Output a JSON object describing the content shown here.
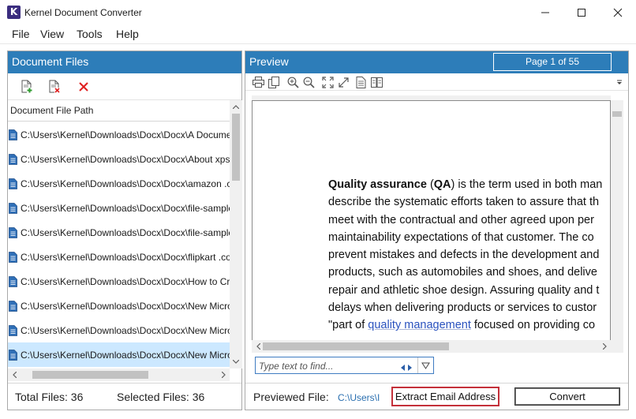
{
  "window": {
    "title": "Kernel Document Converter",
    "logo_letter": "K"
  },
  "menu": [
    "File",
    "View",
    "Tools",
    "Help"
  ],
  "left_panel": {
    "header": "Document Files",
    "column_header": "Document File Path",
    "files": [
      "C:\\Users\\Kernel\\Downloads\\Docx\\Docx\\A Document",
      "C:\\Users\\Kernel\\Downloads\\Docx\\Docx\\About xps.",
      "C:\\Users\\Kernel\\Downloads\\Docx\\Docx\\amazon .co",
      "C:\\Users\\Kernel\\Downloads\\Docx\\Docx\\file-sample",
      "C:\\Users\\Kernel\\Downloads\\Docx\\Docx\\file-sample",
      "C:\\Users\\Kernel\\Downloads\\Docx\\Docx\\flipkart .co",
      "C:\\Users\\Kernel\\Downloads\\Docx\\Docx\\How to Cre",
      "C:\\Users\\Kernel\\Downloads\\Docx\\Docx\\New Micro",
      "C:\\Users\\Kernel\\Downloads\\Docx\\Docx\\New Micro",
      "C:\\Users\\Kernel\\Downloads\\Docx\\Docx\\New Micro"
    ],
    "selected_index": 9,
    "total_files": "Total Files: 36",
    "selected_files": "Selected Files: 36"
  },
  "preview": {
    "header": "Preview",
    "page_indicator": "Page 1 of 55",
    "find_placeholder": "Type text to find...",
    "doc_lines": [
      {
        "parts": [
          {
            "t": "Quality assurance",
            "s": "b"
          },
          {
            "t": " ("
          },
          {
            "t": "QA",
            "s": "b"
          },
          {
            "t": ") is the term used in both man"
          }
        ]
      },
      {
        "parts": [
          {
            "t": "describe the systematic efforts taken to assure that th"
          }
        ]
      },
      {
        "parts": [
          {
            "t": "meet with the contractual and other agreed upon per"
          }
        ]
      },
      {
        "parts": [
          {
            "t": "maintainability expectations of that customer. The co"
          }
        ]
      },
      {
        "parts": [
          {
            "t": "prevent mistakes and defects in the development and"
          }
        ]
      },
      {
        "parts": [
          {
            "t": "products, such as automobiles and shoes, and delive"
          }
        ]
      },
      {
        "parts": [
          {
            "t": "repair and athletic shoe design. Assuring quality and t"
          }
        ]
      },
      {
        "parts": [
          {
            "t": "delays when delivering products or services to custor"
          }
        ]
      },
      {
        "parts": [
          {
            "t": "\"part of "
          },
          {
            "t": "quality management",
            "s": "lnk"
          },
          {
            "t": " focused on providing co"
          }
        ]
      }
    ],
    "previewed_file_label": "Previewed File:",
    "previewed_file_value": "C:\\Users\\I",
    "extract_button": "Extract Email Address",
    "convert_button": "Convert"
  },
  "colors": {
    "header_blue": "#2d7db9",
    "selection": "#cce8ff",
    "highlight_border": "#c4303a",
    "logo_purple": "#3b2d7f"
  }
}
